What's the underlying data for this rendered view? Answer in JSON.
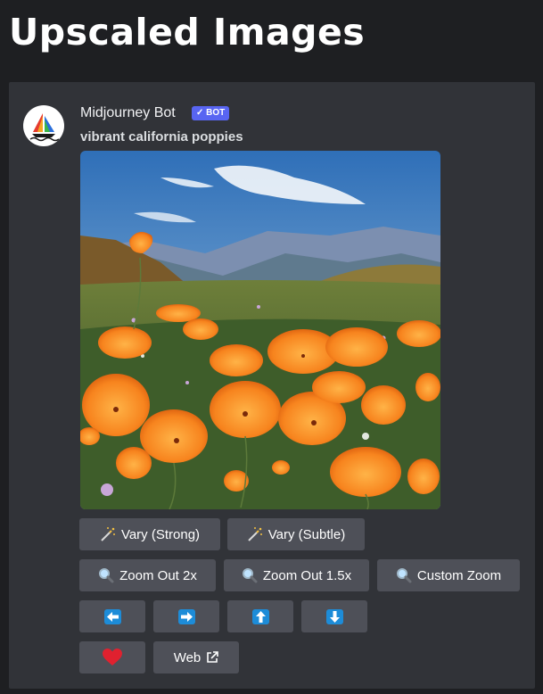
{
  "page": {
    "title": "Upscaled Images"
  },
  "message": {
    "username": "Midjourney Bot",
    "bot_tag": "✓ BOT",
    "prompt": "vibrant california poppies"
  },
  "buttons": {
    "vary_strong": "Vary (Strong)",
    "vary_subtle": "Vary (Subtle)",
    "zoom_out_2x": "Zoom Out 2x",
    "zoom_out_15x": "Zoom Out 1.5x",
    "custom_zoom": "Custom Zoom",
    "web": "Web"
  },
  "icons": {
    "vary": "magic-wand-icon",
    "zoom": "magnifier-icon",
    "pan_left": "arrow-left-icon",
    "pan_right": "arrow-right-icon",
    "pan_up": "arrow-up-icon",
    "pan_down": "arrow-down-icon",
    "favorite": "heart-icon",
    "external": "external-link-icon"
  },
  "colors": {
    "background": "#1e1f22",
    "panel": "#313338",
    "button": "#4e5058",
    "bot_tag": "#5865f2",
    "arrow": "#1d8cd8",
    "heart": "#e0212f"
  }
}
